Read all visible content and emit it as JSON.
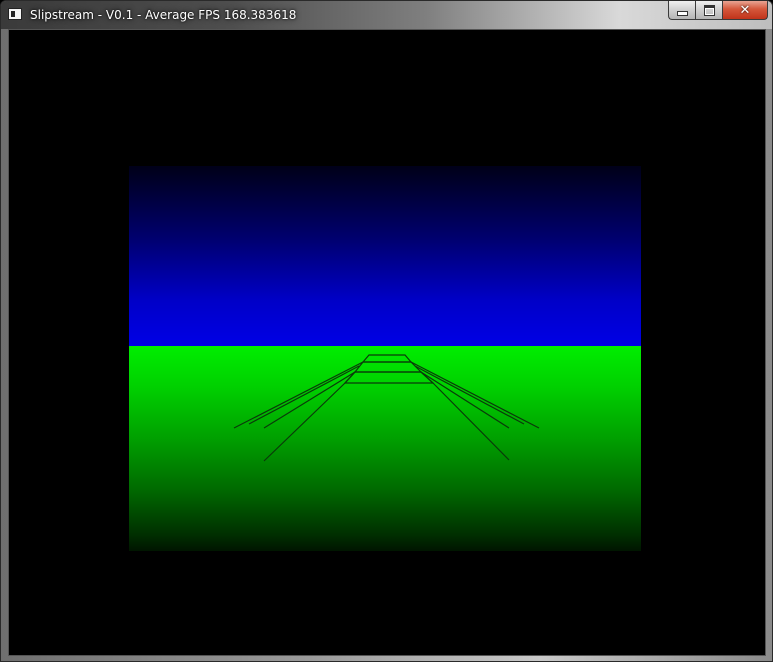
{
  "window": {
    "title": "Slipstream - V0.1 - Average FPS 168.383618",
    "app_icon": "application-icon",
    "minimize_icon": "minimize-icon",
    "maximize_icon": "maximize-icon",
    "close_icon": "close-icon",
    "close_glyph": "✕"
  },
  "scene": {
    "sky_color_top": "#000018",
    "sky_color_bottom": "#0000e6",
    "ground_color_top": "#00ee00",
    "ground_color_bottom": "#001500",
    "track_line_color": "#0a3a0a"
  }
}
